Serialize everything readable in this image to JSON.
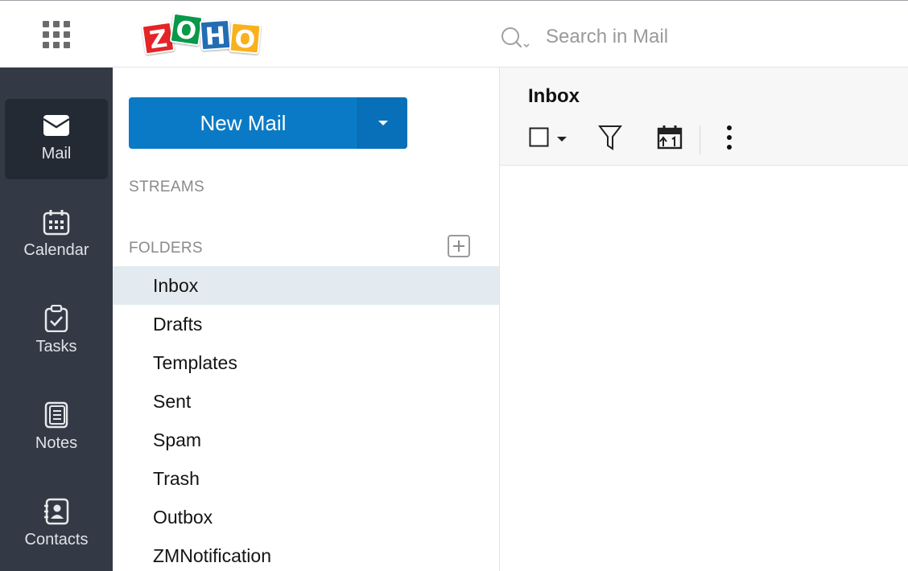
{
  "header": {
    "logo_letters": [
      "Z",
      "O",
      "H",
      "O"
    ],
    "logo_colors": [
      "#e42527",
      "#089949",
      "#226db4",
      "#f9b21d"
    ],
    "search_placeholder": "Search in Mail"
  },
  "rail": {
    "items": [
      {
        "label": "Mail",
        "icon": "mail-icon",
        "active": true
      },
      {
        "label": "Calendar",
        "icon": "calendar-icon",
        "active": false
      },
      {
        "label": "Tasks",
        "icon": "tasks-icon",
        "active": false
      },
      {
        "label": "Notes",
        "icon": "notes-icon",
        "active": false
      },
      {
        "label": "Contacts",
        "icon": "contacts-icon",
        "active": false
      }
    ]
  },
  "folders_panel": {
    "new_mail_label": "New Mail",
    "streams_label": "STREAMS",
    "folders_label": "FOLDERS",
    "folders": [
      "Inbox",
      "Drafts",
      "Templates",
      "Sent",
      "Spam",
      "Trash",
      "Outbox",
      "ZMNotification"
    ],
    "selected_folder": "Inbox"
  },
  "main": {
    "title": "Inbox",
    "toolbar": [
      "select-checkbox",
      "filter-icon",
      "calendar-sort-icon",
      "more-icon"
    ]
  },
  "colors": {
    "accent": "#0a7ac6",
    "rail_bg": "#333a45",
    "selected_folder_bg": "#e3ebf0"
  }
}
